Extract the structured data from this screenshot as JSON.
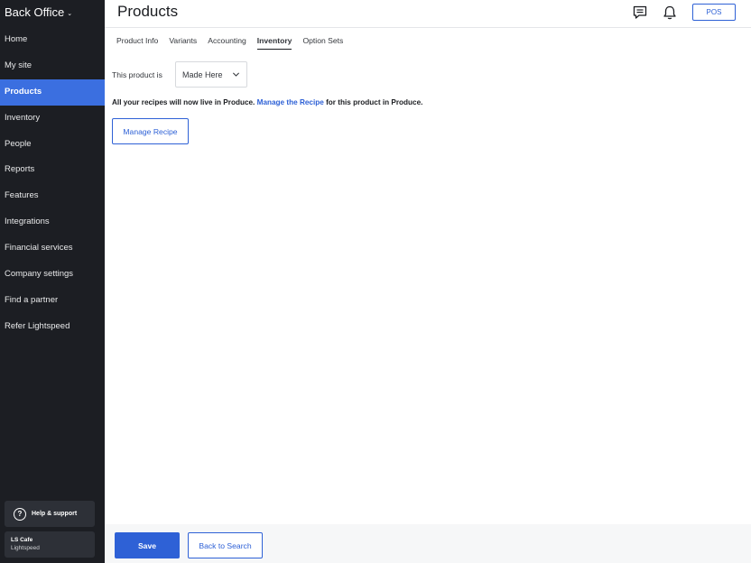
{
  "app": {
    "brand": "Back Office"
  },
  "sidebar": {
    "items": [
      {
        "label": "Home"
      },
      {
        "label": "My site"
      },
      {
        "label": "Products"
      },
      {
        "label": "Inventory"
      },
      {
        "label": "People"
      },
      {
        "label": "Reports"
      },
      {
        "label": "Features"
      },
      {
        "label": "Integrations"
      },
      {
        "label": "Financial services"
      },
      {
        "label": "Company settings"
      },
      {
        "label": "Find a partner"
      },
      {
        "label": "Refer Lightspeed"
      }
    ],
    "active_item": "Products",
    "help_label": "Help & support",
    "account_name": "LS Cafe",
    "account_sub": "Lightspeed"
  },
  "header": {
    "title": "Products",
    "pos_label": "POS",
    "icons": [
      "chat-icon",
      "bell-icon"
    ]
  },
  "tabs": [
    {
      "label": "Product Info"
    },
    {
      "label": "Variants"
    },
    {
      "label": "Accounting"
    },
    {
      "label": "Inventory"
    },
    {
      "label": "Option Sets"
    }
  ],
  "active_tab": "Inventory",
  "content": {
    "product_is_label": "This product is",
    "product_type_value": "Made Here",
    "info_prefix": "All your recipes will now live in Produce.",
    "info_link": "Manage the Recipe",
    "info_suffix": "for this product in Produce.",
    "manage_recipe_label": "Manage Recipe"
  },
  "footer": {
    "save_label": "Save",
    "back_label": "Back to Search"
  },
  "colors": {
    "sidebar_bg": "#1c1e23",
    "active_nav": "#3b6fe0",
    "accent": "#2e61d6"
  }
}
